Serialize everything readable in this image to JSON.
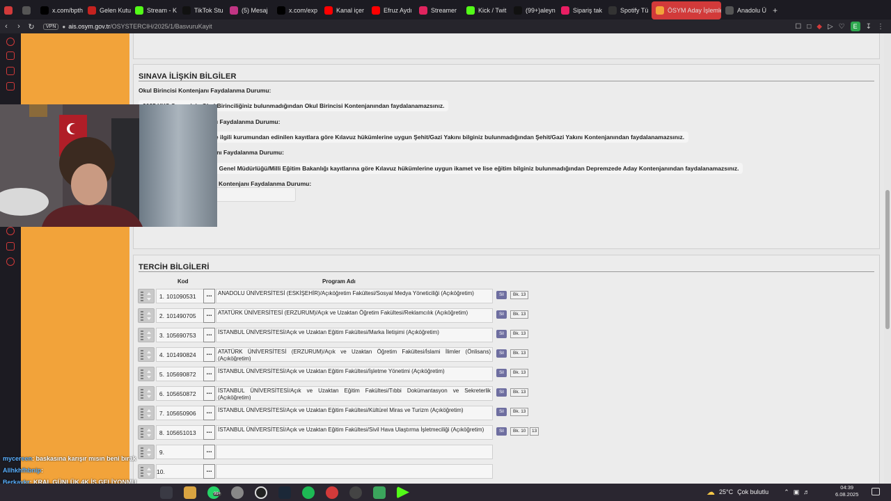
{
  "browser": {
    "tabs": [
      {
        "label": "",
        "icon": "browser-logo",
        "color": "#d23a3a"
      },
      {
        "label": "",
        "icon": "window-icon",
        "color": "#555"
      },
      {
        "label": "x.com/bpth",
        "icon": "x-icon",
        "color": "#000"
      },
      {
        "label": "Gelen Kutu",
        "icon": "gmail-icon",
        "color": "#c5221f"
      },
      {
        "label": "Stream - K",
        "icon": "kick-icon",
        "color": "#53fc18"
      },
      {
        "label": "TikTok Stu",
        "icon": "tiktok-icon",
        "color": "#111"
      },
      {
        "label": "(5) Mesaj",
        "icon": "instagram-icon",
        "color": "#c13584"
      },
      {
        "label": "x.com/exp",
        "icon": "x-icon",
        "color": "#000"
      },
      {
        "label": "Kanal içer",
        "icon": "youtube-icon",
        "color": "#ff0000"
      },
      {
        "label": "Efruz Aydı",
        "icon": "youtube-icon",
        "color": "#ff0000"
      },
      {
        "label": "Streamer",
        "icon": "streamer-icon",
        "color": "#e0245e"
      },
      {
        "label": "Kick / Twit",
        "icon": "kick-icon",
        "color": "#53fc18"
      },
      {
        "label": "(99+)aleyn",
        "icon": "tiktok-icon",
        "color": "#111"
      },
      {
        "label": "Sipariş tak",
        "icon": "y-icon",
        "color": "#e91e63"
      },
      {
        "label": "Spotify Tü",
        "icon": "spotify-icon",
        "color": "#333"
      },
      {
        "label": "ÖSYM Aday İşlemle",
        "icon": "osym-icon",
        "color": "#f2a33a",
        "active": true
      },
      {
        "label": "Anadolu Ü",
        "icon": "bank-icon",
        "color": "#555"
      }
    ],
    "vpn_label": "VPN",
    "url_domain": "ais.osym.gov.tr",
    "url_path": "/OSYSTERCIH/2025/1/BasvuruKayit",
    "extension_label": "E"
  },
  "sinav": {
    "title": "SINAVA İLİŞKİN BİLGİLER",
    "okul_label": "Okul Birincisi Kontenjanı Faydalanma Durumu:",
    "okul_msg": "2025 YKS Sınavı için Okul Birinciliğiniz bulunmadığından Okul Birincisi Kontenjanından faydalanamazsınız.",
    "sehit_label": "Şehit/Gazi Yakını Kontenjanı Faydalanma Durumu:",
    "sehit_msg": "Milli Savunma Bakanlığı ve ilgili kurumundan edinilen kayıtlara göre Kılavuz hükümlerine uygun Şehit/Gazi Yakını bilginiz bulunmadığından Şehit/Gazi Yakını Kontenjanından faydalanamazsınız.",
    "deprem_label": "Depremzede Aday Kontenjanı Faydalanma Durumu:",
    "deprem_msg": "Nüfus ve Vatandaşlık İşleri Genel Müdürlüğü/Milli Eğitim Bakanlığı kayıtlarına göre Kılavuz hükümlerine uygun ikamet ve lise eğitim bilginiz bulunmadığından Depremzede Aday Kontenjanından faydalanamazsınız.",
    "diger_label": "Kontenjanı Faydalanma Durumu:"
  },
  "tercih": {
    "title": "TERCİH BİLGİLERİ",
    "col_kod": "Kod",
    "col_program": "Program Adı",
    "sil_label": "Sil",
    "more_label": "...",
    "rows": [
      {
        "no": "1.",
        "kod": "101090531",
        "program": "ANADOLU ÜNİVERSİTESİ (ESKİŞEHİR)/Açıköğretim Fakültesi/Sosyal Medya Yöneticiliği (Açıköğretim)",
        "bk": "Bk. 13",
        "bk2": ""
      },
      {
        "no": "2.",
        "kod": "101490705",
        "program": "ATATÜRK ÜNİVERSİTESİ (ERZURUM)/Açık ve Uzaktan Öğretim Fakültesi/Reklamcılık (Açıköğretim)",
        "bk": "Bk. 13",
        "bk2": ""
      },
      {
        "no": "3.",
        "kod": "105690753",
        "program": "İSTANBUL ÜNİVERSİTESİ/Açık ve Uzaktan Eğitim Fakültesi/Marka İletişimi (Açıköğretim)",
        "bk": "Bk. 13",
        "bk2": ""
      },
      {
        "no": "4.",
        "kod": "101490824",
        "program": "ATATÜRK ÜNİVERSİTESİ (ERZURUM)/Açık ve Uzaktan Öğretim Fakültesi/İslami İlimler (Önlisans) (Açıköğretim)",
        "bk": "Bk. 13",
        "bk2": ""
      },
      {
        "no": "5.",
        "kod": "105690872",
        "program": "İSTANBUL ÜNİVERSİTESİ/Açık ve Uzaktan Eğitim Fakültesi/İşletme Yönetimi (Açıköğretim)",
        "bk": "Bk. 13",
        "bk2": ""
      },
      {
        "no": "6.",
        "kod": "105650872",
        "program": "İSTANBUL ÜNİVERSİTESİ/Açık ve Uzaktan Eğitim Fakültesi/Tıbbi Dokümantasyon ve Sekreterlik (Açıköğretim)",
        "bk": "Bk. 13",
        "bk2": ""
      },
      {
        "no": "7.",
        "kod": "105650906",
        "program": "İSTANBUL ÜNİVERSİTESİ/Açık ve Uzaktan Eğitim Fakültesi/Kültürel Miras ve Turizm (Açıköğretim)",
        "bk": "Bk. 13",
        "bk2": ""
      },
      {
        "no": "8.",
        "kod": "105651013",
        "program": "İSTANBUL ÜNİVERSİTESİ/Açık ve Uzaktan Eğitim Fakültesi/Sivil Hava Ulaştırma İşletmeciliği (Açıköğretim)",
        "bk": "Bk. 10",
        "bk2": "13"
      },
      {
        "no": "9.",
        "kod": "",
        "program": "",
        "bk": "",
        "bk2": ""
      },
      {
        "no": "10.",
        "kod": "",
        "program": "",
        "bk": "",
        "bk2": ""
      }
    ]
  },
  "chat": [
    {
      "user": "mycereen",
      "text": ": baskasına karışır mısın beni bırak"
    },
    {
      "user": "Allhkhfhbnip",
      "text": ": "
    },
    {
      "user": "Berkaykr",
      "text": ": KRAL GÜNLÜK 4K İŞ GELİYONMU"
    },
    {
      "user": "newininthehouse",
      "text": ": abi valoda rankin ns"
    }
  ],
  "taskbar": {
    "weather_temp": "25°C",
    "weather_text": "Çok bulutlu",
    "time": "04:39",
    "date": "6.08.2025",
    "whatsapp_badge": "99+"
  }
}
